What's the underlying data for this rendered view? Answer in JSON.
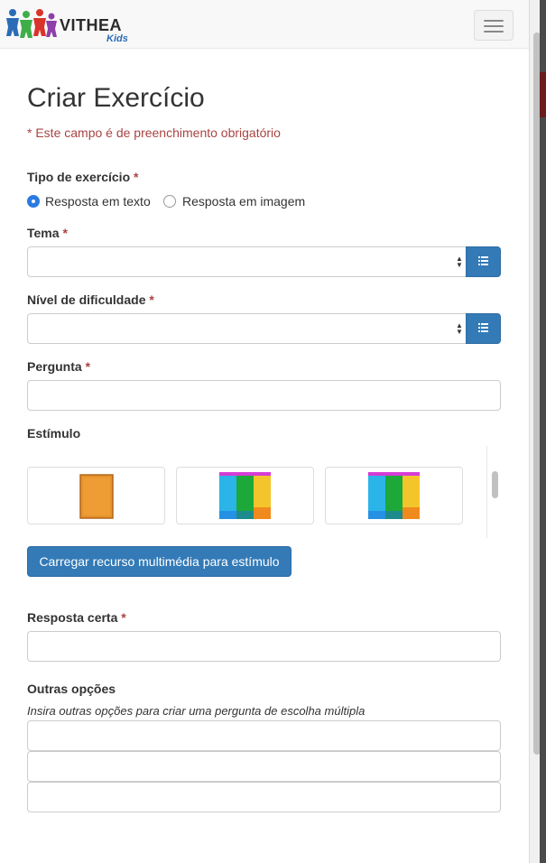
{
  "brand": {
    "name": "VITHEA",
    "sub": "Kids"
  },
  "page": {
    "title": "Criar Exercício",
    "required_note": "* Este campo é de preenchimento obrigatório"
  },
  "form": {
    "exercise_type": {
      "label": "Tipo de exercício",
      "required_mark": "*",
      "options": [
        {
          "label": "Resposta em texto",
          "checked": true
        },
        {
          "label": "Resposta em imagem",
          "checked": false
        }
      ]
    },
    "theme": {
      "label": "Tema",
      "required_mark": "*",
      "value": ""
    },
    "difficulty": {
      "label": "Nível de dificuldade",
      "required_mark": "*",
      "value": ""
    },
    "question": {
      "label": "Pergunta",
      "required_mark": "*",
      "value": ""
    },
    "stimulus": {
      "label": "Estímulo"
    },
    "upload_label": "Carregar recurso multimédia para estímulo",
    "correct_answer": {
      "label": "Resposta certa",
      "required_mark": "*",
      "value": ""
    },
    "other_options": {
      "label": "Outras opções",
      "help": "Insira outras opções para criar uma pergunta de escolha múltipla",
      "values": [
        "",
        "",
        ""
      ]
    }
  },
  "icons": {
    "menu": "hamburger-icon",
    "list": "list-icon",
    "logo": "puzzle-people-logo"
  },
  "colors": {
    "primary": "#337ab7",
    "required": "#a94442",
    "radio_checked": "#2a7ae2"
  }
}
